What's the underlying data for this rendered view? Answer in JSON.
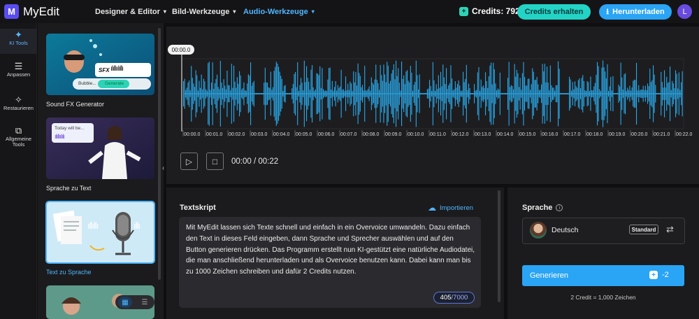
{
  "app": {
    "name": "MyEdit",
    "logo_letter": "M",
    "user_initial": "L"
  },
  "nav": [
    {
      "label": "Designer & Editor",
      "active": false
    },
    {
      "label": "Bild-Werkzeuge",
      "active": false
    },
    {
      "label": "Audio-Werkzeuge",
      "active": true
    }
  ],
  "credits": {
    "label": "Credits: 792",
    "get_button": "Credits erhalten",
    "download_button": "Herunterladen"
  },
  "sidebar": {
    "items": [
      {
        "label": "KI Tools",
        "icon": "magic-wand-icon",
        "active": true
      },
      {
        "label": "Anpassen",
        "icon": "sliders-icon",
        "active": false
      },
      {
        "label": "Restaurieren",
        "icon": "restore-icon",
        "active": false
      },
      {
        "label": "Allgemeine Tools",
        "icon": "tools-icon",
        "active": false
      }
    ]
  },
  "tools": [
    {
      "label": "Sound FX Generator",
      "badge": "SFX",
      "prompt": "Bubble...",
      "button": "Generate"
    },
    {
      "label": "Sprache zu Text",
      "bubble": "Today will be..."
    },
    {
      "label": "Text zu Sprache",
      "active": true
    },
    {
      "label": ""
    }
  ],
  "player": {
    "playhead_label": "00:00.0",
    "time_display": "00:00 / 00:22",
    "ticks": [
      "00:00.0",
      "00:01.0",
      "00:02.0",
      "00:03.0",
      "00:04.0",
      "00:05.0",
      "00:06.0",
      "00:07.0",
      "00:08.0",
      "00:09.0",
      "00:10.0",
      "00:11.0",
      "00:12.0",
      "00:13.0",
      "00:14.0",
      "00:15.0",
      "00:16.0",
      "00:17.0",
      "00:18.0",
      "00:19.0",
      "00:20.0",
      "00:21.0",
      "00:22.0"
    ],
    "wave_color": "#2aa9e8"
  },
  "script": {
    "title": "Textskript",
    "import_label": "Importieren",
    "text": "Mit MyEdit lassen sich Texte schnell und einfach in ein Overvoice umwandeln. Dazu einfach den Text in dieses Feld eingeben, dann Sprache und Sprecher auswählen und auf den Button generieren drücken. Das Programm erstellt nun KI-gestützt eine natürliche Audiodatei, die man anschließend herunterladen und als Overvoice benutzen kann. Dabei kann man bis zu 1000 Zeichen schreiben und dafür 2 Credits nutzen.",
    "count": "405",
    "max": "/7000"
  },
  "language": {
    "title": "Sprache",
    "name": "Deutsch",
    "badge": "Standard",
    "generate_label": "Generieren",
    "generate_cost": "-2",
    "note": "2 Credit = 1,000 Zeichen"
  }
}
